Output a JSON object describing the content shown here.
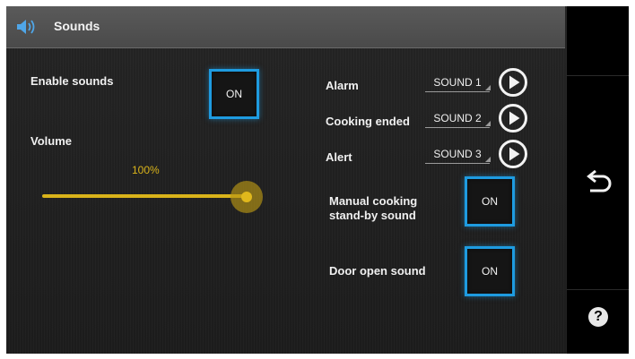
{
  "header": {
    "title": "Sounds",
    "icon": "speaker-icon"
  },
  "enable_sounds": {
    "label": "Enable sounds",
    "state": "ON"
  },
  "volume": {
    "label": "Volume",
    "value_text": "100%",
    "value_fraction": 1.0
  },
  "sound_rows": [
    {
      "label": "Alarm",
      "selected": "SOUND 1"
    },
    {
      "label": "Cooking ended",
      "selected": "SOUND 2"
    },
    {
      "label": "Alert",
      "selected": "SOUND 3"
    }
  ],
  "manual_cooking": {
    "label_line1": "Manual cooking",
    "label_line2": "stand-by sound",
    "state": "ON"
  },
  "door_open": {
    "label": "Door open sound",
    "state": "ON"
  },
  "sidebar": {
    "back_icon": "back-arrow-icon",
    "help_icon": "help-icon",
    "help_symbol": "?"
  },
  "colors": {
    "accent_blue": "#1e9be0",
    "slider_gold": "#d9b31a"
  }
}
